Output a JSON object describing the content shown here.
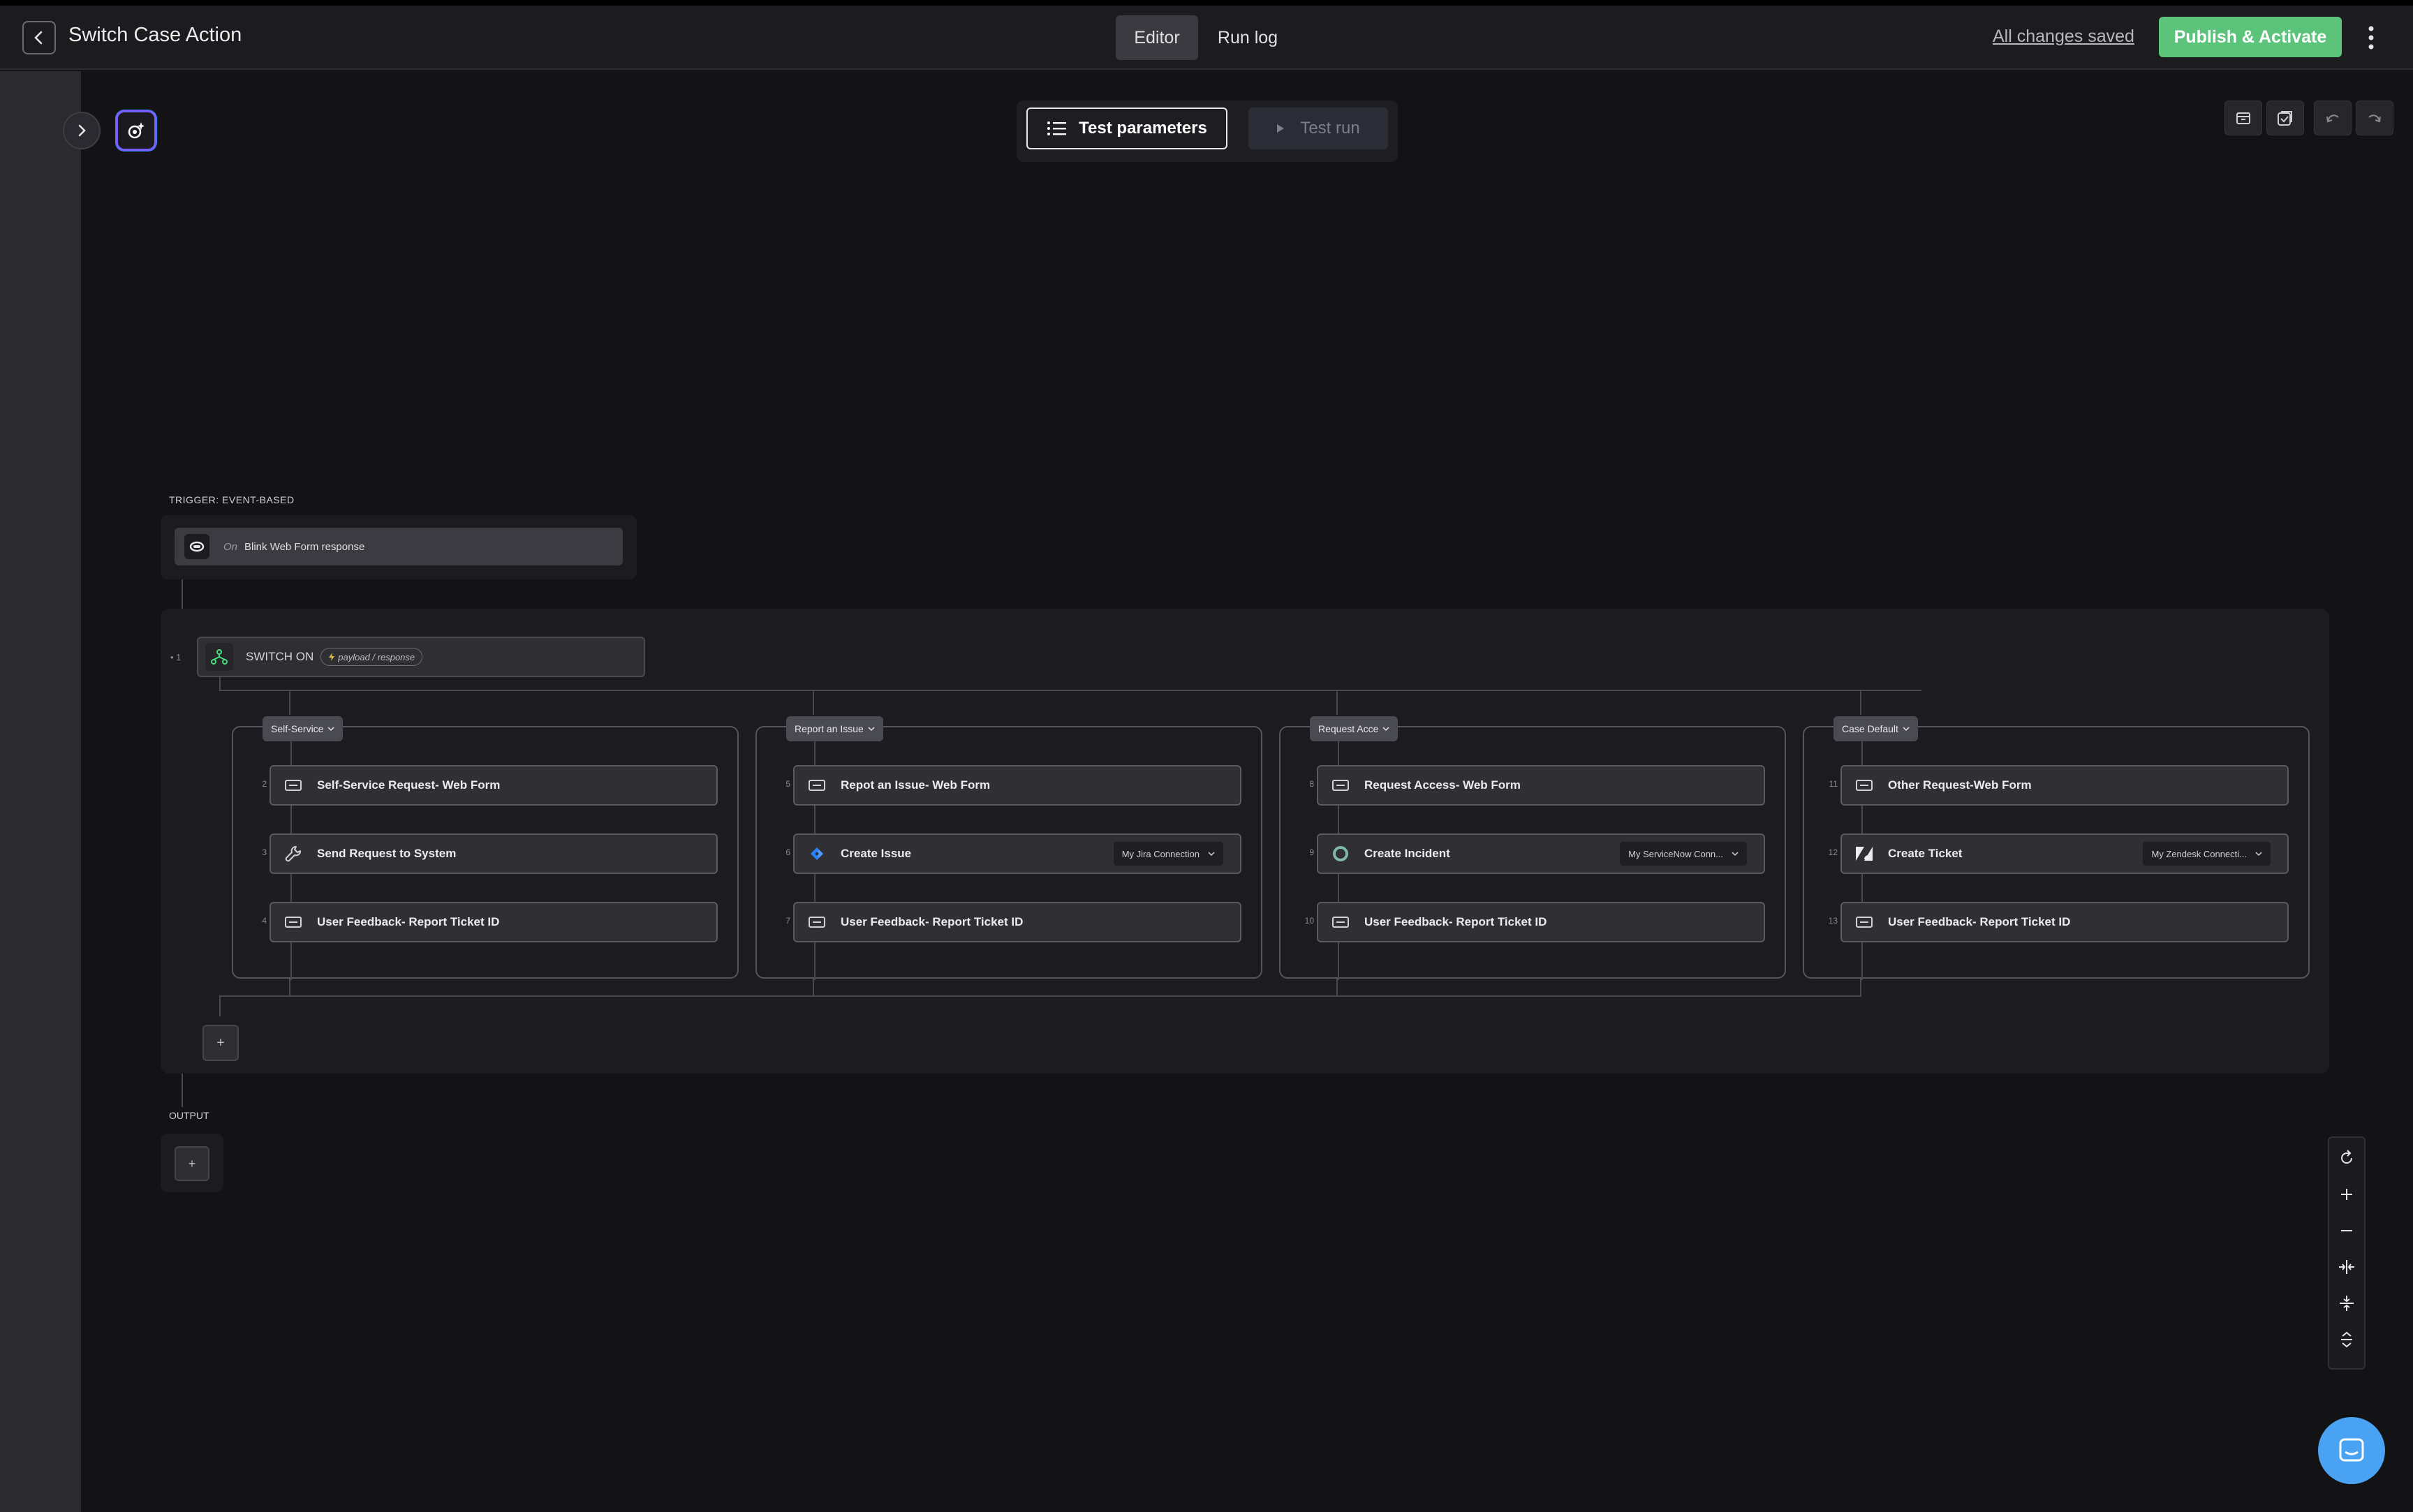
{
  "header": {
    "title": "Switch Case Action",
    "tabs": [
      {
        "label": "Editor",
        "active": true
      },
      {
        "label": "Run log",
        "active": false
      }
    ],
    "saved_status": "All changes saved",
    "publish_label": "Publish & Activate"
  },
  "toolbar": {
    "test_params_label": "Test parameters",
    "test_run_label": "Test run"
  },
  "trigger": {
    "label": "TRIGGER: EVENT-BASED",
    "on": "On",
    "text": "Blink Web Form response"
  },
  "switch": {
    "num": "• 1",
    "label": "SWITCH ON",
    "chip": "payload / response"
  },
  "branches": [
    {
      "tag": "Self-Service",
      "steps": [
        {
          "num": "2",
          "title": "Self-Service Request- Web Form",
          "icon": "form-icon"
        },
        {
          "num": "3",
          "title": "Send Request to System",
          "icon": "wrench-icon"
        },
        {
          "num": "4",
          "title": "User Feedback- Report Ticket ID",
          "icon": "form-icon"
        }
      ]
    },
    {
      "tag": "Report an Issue",
      "steps": [
        {
          "num": "5",
          "title": "Repot an Issue- Web Form",
          "icon": "form-icon"
        },
        {
          "num": "6",
          "title": "Create Issue",
          "icon": "jira-icon",
          "connection": "My Jira Connection"
        },
        {
          "num": "7",
          "title": "User Feedback- Report Ticket ID",
          "icon": "form-icon"
        }
      ]
    },
    {
      "tag": "Request Acce",
      "steps": [
        {
          "num": "8",
          "title": "Request Access- Web Form",
          "icon": "form-icon"
        },
        {
          "num": "9",
          "title": "Create Incident",
          "icon": "servicenow-icon",
          "connection": "My ServiceNow Conn..."
        },
        {
          "num": "10",
          "title": "User Feedback- Report Ticket ID",
          "icon": "form-icon"
        }
      ]
    },
    {
      "tag": "Case Default",
      "steps": [
        {
          "num": "11",
          "title": "Other Request-Web Form",
          "icon": "form-icon"
        },
        {
          "num": "12",
          "title": "Create Ticket",
          "icon": "zendesk-icon",
          "connection": "My Zendesk Connecti..."
        },
        {
          "num": "13",
          "title": "User Feedback- Report Ticket ID",
          "icon": "form-icon"
        }
      ]
    }
  ],
  "add_step": "+",
  "output": {
    "label": "OUTPUT",
    "plus": "+"
  },
  "colors": {
    "accent_green": "#5cc37b",
    "chat_blue": "#4aa3f2",
    "canvas_bg": "#131315"
  }
}
